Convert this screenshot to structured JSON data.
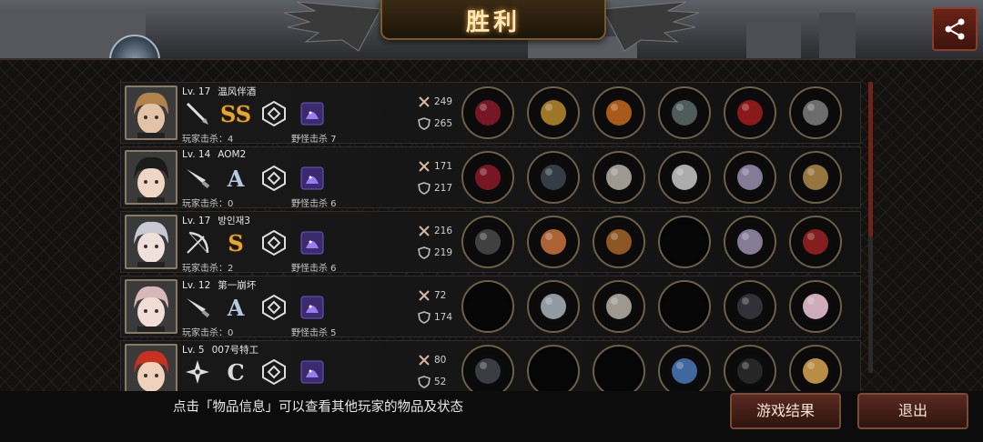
{
  "header": {
    "title": "胜利",
    "share_icon": "share-icon"
  },
  "players": [
    {
      "level": "Lv. 17",
      "name": "温风伴酒",
      "weapon_icon": "dagger-icon",
      "grade": "SS",
      "class_icon": "hexagon-crest-icon",
      "pet_icon": "purple-pet-icon",
      "pvp_label": "玩家击杀：4",
      "pve_label": "野怪击杀 7",
      "attack": "249",
      "defense": "265",
      "equipment": [
        "red-sword-icon",
        "gold-helmet-icon",
        "flame-armor-icon",
        "laptop-icon",
        "red-heels-icon",
        "stone-gauntlet-icon"
      ],
      "hair": "#b0824e",
      "skin": "#e3c3a6"
    },
    {
      "level": "Lv. 14",
      "name": "AOM2",
      "weapon_icon": "knife-icon",
      "grade": "A",
      "class_icon": "diamond-crest-icon",
      "pet_icon": "purple-pet-icon",
      "pvp_label": "玩家击杀：0",
      "pve_label": "野怪击杀 6",
      "attack": "171",
      "defense": "217",
      "equipment": [
        "red-sword-icon",
        "dark-helmet-icon",
        "plate-armor-icon",
        "spiked-gauntlet-icon",
        "violet-boots-icon",
        "treasure-chest-icon"
      ],
      "hair": "#1b1b1b",
      "skin": "#efd6c4"
    },
    {
      "level": "Lv. 17",
      "name": "방인재3",
      "weapon_icon": "bow-icon",
      "grade": "S",
      "class_icon": "heptagon-crest-icon",
      "pet_icon": "purple-pet-icon",
      "pvp_label": "玩家击杀：2",
      "pve_label": "野怪击杀 6",
      "attack": "216",
      "defense": "219",
      "equipment": [
        "crossbow-icon",
        "tiara-icon",
        "bronze-armor-icon",
        "empty",
        "violet-boots-icon",
        "red-quiver-icon"
      ],
      "hair": "#c9c9d6",
      "skin": "#f0e0dc"
    },
    {
      "level": "Lv. 12",
      "name": "第一崩坏",
      "weapon_icon": "knife-icon",
      "grade": "A",
      "class_icon": "diamond-crest-icon",
      "pet_icon": "purple-pet-icon",
      "pvp_label": "玩家击杀：0",
      "pve_label": "野怪击杀 5",
      "attack": "72",
      "defense": "174",
      "equipment": [
        "empty",
        "silver-helmet-icon",
        "plate-armor-icon",
        "empty",
        "dark-gauntlet-icon",
        "pearl-icon"
      ],
      "hair": "#d8b7b8",
      "skin": "#f2dcd6"
    },
    {
      "level": "Lv. 5",
      "name": "007号特工",
      "weapon_icon": "shuriken-icon",
      "grade": "C",
      "class_icon": "triangle-crest-icon",
      "pet_icon": "purple-pet-icon",
      "pvp_label": "",
      "pve_label": "",
      "attack": "80",
      "defense": "52",
      "equipment": [
        "dark-blade-icon",
        "empty",
        "empty",
        "blue-necklace-icon",
        "black-boots-icon",
        "gold-fan-icon"
      ],
      "hair": "#c8311f",
      "skin": "#f0d1bb"
    }
  ],
  "footer": {
    "hint": "点击「物品信息」可以查看其他玩家的物品及状态",
    "result_button": "游戏结果",
    "exit_button": "退出"
  },
  "colors": {
    "accent_gold": "#e8a531",
    "button_red": "#5a2a20",
    "slot_border": "#6e5f47"
  }
}
